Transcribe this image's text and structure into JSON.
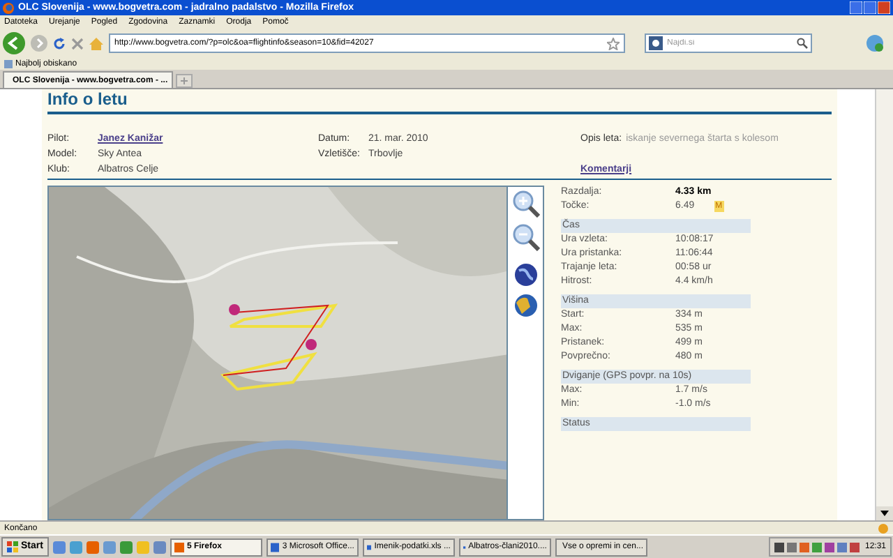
{
  "window": {
    "title": "OLC Slovenija - www.bogvetra.com - jadralno padalstvo - Mozilla Firefox"
  },
  "menu": [
    "Datoteka",
    "Urejanje",
    "Pogled",
    "Zgodovina",
    "Zaznamki",
    "Orodja",
    "Pomoč"
  ],
  "toolbar": {
    "url": "http://www.bogvetra.com/?p=olc&oa=flightinfo&season=10&fid=42027",
    "search_placeholder": "Najdi.si"
  },
  "bookmarks": [
    "Najbolj obiskano"
  ],
  "tabs": [
    {
      "label": "OLC Slovenija - www.bogvetra.com - ...",
      "selected": true
    }
  ],
  "page": {
    "heading": "Info o letu",
    "info_columns": [
      [
        {
          "label": "Pilot:",
          "value": "Janez Kanižar",
          "kind": "link"
        },
        {
          "label": "Model:",
          "value": "Sky Antea",
          "kind": "text"
        },
        {
          "label": "Klub:",
          "value": "Albatros Celje",
          "kind": "text"
        }
      ],
      [
        {
          "label": "Datum:",
          "value": "21. mar. 2010",
          "kind": "text"
        },
        {
          "label": "Vzletišče:",
          "value": "Trbovlje",
          "kind": "text"
        }
      ],
      [
        {
          "label": "Opis leta:",
          "value": "iskanje severnega štarta s kolesom",
          "kind": "note"
        }
      ]
    ],
    "comments_link": "Komentarji",
    "map": {
      "kind": "picture"
    },
    "stats_top": [
      {
        "label": "Razdalja:",
        "value": "4.33 km",
        "kind": "bold"
      },
      {
        "label": "Točke:",
        "value": "6.49",
        "kind": "badge",
        "badge": "M"
      }
    ],
    "sections": [
      {
        "title": "Čas",
        "rows": [
          {
            "label": "Ura vzleta:",
            "value": "10:08:17"
          },
          {
            "label": "Ura pristanka:",
            "value": "11:06:44"
          },
          {
            "label": "Trajanje leta:",
            "value": "00:58 ur"
          },
          {
            "label": "Hitrost:",
            "value": "4.4 km/h"
          }
        ]
      },
      {
        "title": "Višina",
        "rows": [
          {
            "label": "Start:",
            "value": "334 m"
          },
          {
            "label": "Max:",
            "value": "535 m"
          },
          {
            "label": "Pristanek:",
            "value": "499 m"
          },
          {
            "label": "Povprečno:",
            "value": "480 m"
          }
        ]
      },
      {
        "title": "Dviganje (GPS povpr. na 10s)",
        "rows": [
          {
            "label": "Max:",
            "value": "1.7 m/s"
          },
          {
            "label": "Min:",
            "value": "-1.0 m/s"
          }
        ]
      },
      {
        "title": "Status"
      }
    ]
  },
  "status_bar": {
    "text": "Končano"
  },
  "taskbar": {
    "start": "Start",
    "tasks": [
      {
        "label": "5 Firefox",
        "selected": true
      },
      {
        "label": "3 Microsoft Office...",
        "selected": false
      },
      {
        "label": "Imenik-podatki.xls ...",
        "selected": false
      },
      {
        "label": "Albatros-člani2010....",
        "selected": false
      },
      {
        "label": "Vse o opremi in cen...",
        "selected": false
      }
    ],
    "clock": "12:31"
  }
}
